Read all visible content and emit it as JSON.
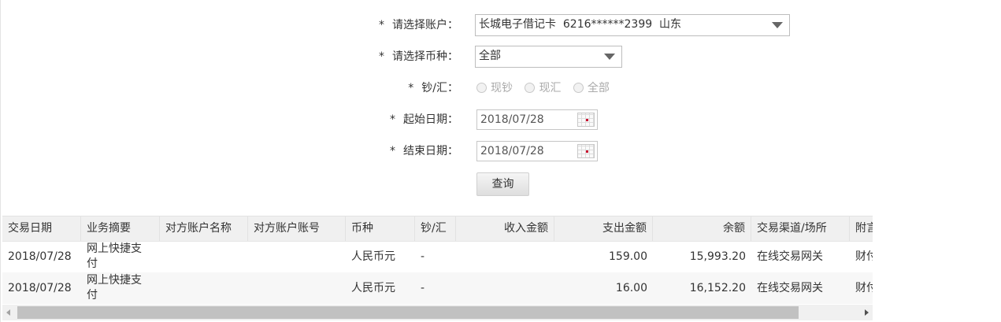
{
  "form": {
    "account": {
      "label": "请选择账户：",
      "value": "长城电子借记卡  6216******2399  山东"
    },
    "currency": {
      "label": "请选择币种：",
      "value": "全部"
    },
    "cash_type": {
      "label": "钞/汇：",
      "options": [
        "现钞",
        "现汇",
        "全部"
      ]
    },
    "start_date": {
      "label": "起始日期：",
      "value": "2018/07/28"
    },
    "end_date": {
      "label": "结束日期：",
      "value": "2018/07/28"
    },
    "required_mark": "*",
    "query_button": "查询"
  },
  "table": {
    "columns": [
      "交易日期",
      "业务摘要",
      "对方账户名称",
      "对方账户账号",
      "币种",
      "钞/汇",
      "收入金额",
      "支出金额",
      "余额",
      "交易渠道/场所",
      "附言"
    ],
    "rows": [
      [
        "2018/07/28",
        "网上快捷支付",
        "",
        "",
        "人民币元",
        "-",
        "",
        "159.00",
        "15,993.20",
        "在线交易网关",
        "财付"
      ],
      [
        "2018/07/28",
        "网上快捷支付",
        "",
        "",
        "人民币元",
        "-",
        "",
        "16.00",
        "16,152.20",
        "在线交易网关",
        "财付"
      ]
    ]
  },
  "colors": {
    "header_bg": "#f0f0f0",
    "alt_row_bg": "#f7f7f7",
    "calendar_accent": "#c8102e"
  },
  "icons": [
    "dropdown-arrow-icon",
    "calendar-icon",
    "scroll-left-arrow-icon",
    "scroll-right-arrow-icon"
  ]
}
